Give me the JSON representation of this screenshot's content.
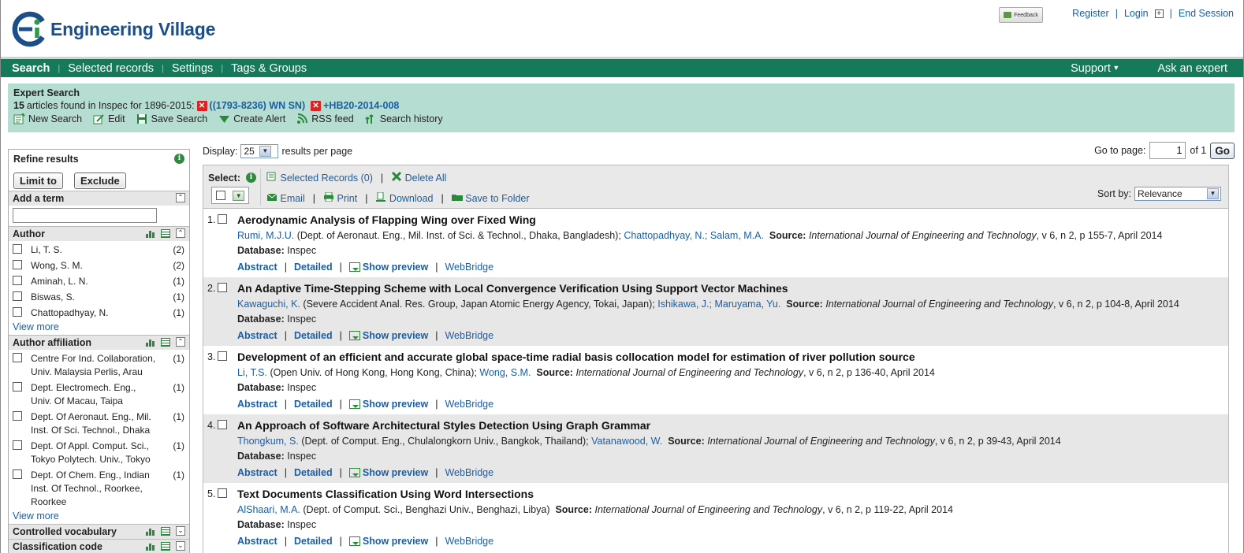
{
  "header": {
    "logo_text": "Engineering Village",
    "feedback": "Feedback",
    "links": [
      "Register",
      "Login",
      "End Session"
    ]
  },
  "nav": {
    "items": [
      "Search",
      "Selected records",
      "Settings",
      "Tags & Groups"
    ],
    "right": [
      "Support",
      "Ask an expert"
    ]
  },
  "query": {
    "title": "Expert Search",
    "count": "15",
    "found_text": "articles found in Inspec for 1896-2015:",
    "term1": "((1793-8236) WN SN)",
    "term2": "+HB20-2014-008",
    "tools": [
      "New Search",
      "Edit",
      "Save Search",
      "Create Alert",
      "RSS feed",
      "Search history"
    ]
  },
  "sidebar": {
    "title": "Refine results",
    "limit_btn": "Limit to",
    "exclude_btn": "Exclude",
    "add_term": "Add a term",
    "author_title": "Author",
    "authors": [
      {
        "label": "Li, T. S.",
        "count": "(2)"
      },
      {
        "label": "Wong, S. M.",
        "count": "(2)"
      },
      {
        "label": "Aminah, L. N.",
        "count": "(1)"
      },
      {
        "label": "Biswas, S.",
        "count": "(1)"
      },
      {
        "label": "Chattopadhyay, N.",
        "count": "(1)"
      }
    ],
    "view_more": "View more",
    "affil_title": "Author affiliation",
    "affiliations": [
      {
        "label": "Centre For Ind. Collaboration, Univ. Malaysia Perlis, Arau",
        "count": "(1)"
      },
      {
        "label": "Dept. Electromech. Eng., Univ. Of Macau, Taipa",
        "count": "(1)"
      },
      {
        "label": "Dept. Of Aeronaut. Eng., Mil. Inst. Of Sci. Technol., Dhaka",
        "count": "(1)"
      },
      {
        "label": "Dept. Of Appl. Comput. Sci., Tokyo Polytech. Univ., Tokyo",
        "count": "(1)"
      },
      {
        "label": "Dept. Of Chem. Eng., Indian Inst. Of Technol., Roorkee, Roorkee",
        "count": "(1)"
      }
    ],
    "controlled_vocab": "Controlled vocabulary",
    "class_code": "Classification code"
  },
  "display": {
    "label": "Display:",
    "value": "25",
    "suffix": "results per page",
    "goto_label": "Go to page:",
    "page": "1",
    "of_text": "of 1",
    "go": "Go"
  },
  "toolbar": {
    "select": "Select:",
    "selected_records": "Selected Records (0)",
    "delete_all": "Delete All",
    "email": "Email",
    "print": "Print",
    "download": "Download",
    "save_folder": "Save to Folder",
    "sort_label": "Sort by:",
    "sort_value": "Relevance"
  },
  "records": [
    {
      "num": "1.",
      "title": "Aerodynamic Analysis of Flapping Wing over Fixed Wing",
      "author1": "Rumi, M.J.U.",
      "affil": "(Dept. of Aeronaut. Eng., Mil. Inst. of Sci. & Technol., Dhaka, Bangladesh);",
      "others": [
        "Chattopadhyay, N.;",
        "Salam, M.A."
      ],
      "source_label": "Source:",
      "journal": "International Journal of Engineering and Technology",
      "citation": ", v 6, n 2, p 155-7, April 2014",
      "db_label": "Database:",
      "db": "Inspec"
    },
    {
      "num": "2.",
      "title": "An Adaptive Time-Stepping Scheme with Local Convergence Verification Using Support Vector Machines",
      "author1": "Kawaguchi, K.",
      "affil": "(Severe Accident Anal. Res. Group, Japan Atomic Energy Agency, Tokai, Japan);",
      "others": [
        "Ishikawa, J.;",
        "Maruyama, Yu."
      ],
      "source_label": "Source:",
      "journal": "International Journal of Engineering and Technology",
      "citation": ", v 6, n 2, p 104-8, April 2014",
      "db_label": "Database:",
      "db": "Inspec"
    },
    {
      "num": "3.",
      "title": "Development of an efficient and accurate global space-time radial basis collocation model for estimation of river pollution source",
      "author1": "Li, T.S.",
      "affil": "(Open Univ. of Hong Kong, Hong Kong, China);",
      "others": [
        "Wong, S.M."
      ],
      "source_label": "Source:",
      "journal": "International Journal of Engineering and Technology",
      "citation": ", v 6, n 2, p 136-40, April 2014",
      "db_label": "Database:",
      "db": "Inspec"
    },
    {
      "num": "4.",
      "title": "An Approach of Software Architectural Styles Detection Using Graph Grammar",
      "author1": "Thongkum, S.",
      "affil": "(Dept. of Comput. Eng., Chulalongkorn Univ., Bangkok, Thailand);",
      "others": [
        "Vatanawood, W."
      ],
      "source_label": "Source:",
      "journal": "International Journal of Engineering and Technology",
      "citation": ", v 6, n 2, p 39-43, April 2014",
      "db_label": "Database:",
      "db": "Inspec"
    },
    {
      "num": "5.",
      "title": "Text Documents Classification Using Word Intersections",
      "author1": "AlShaari, M.A.",
      "affil": "(Dept. of Comput. Sci., Benghazi Univ., Benghazi, Libya)",
      "others": [],
      "source_label": "Source:",
      "journal": "International Journal of Engineering and Technology",
      "citation": ", v 6, n 2, p 119-22, April 2014",
      "db_label": "Database:",
      "db": "Inspec"
    }
  ],
  "record_actions": [
    "Abstract",
    "Detailed",
    "Show preview",
    "WebBridge"
  ]
}
